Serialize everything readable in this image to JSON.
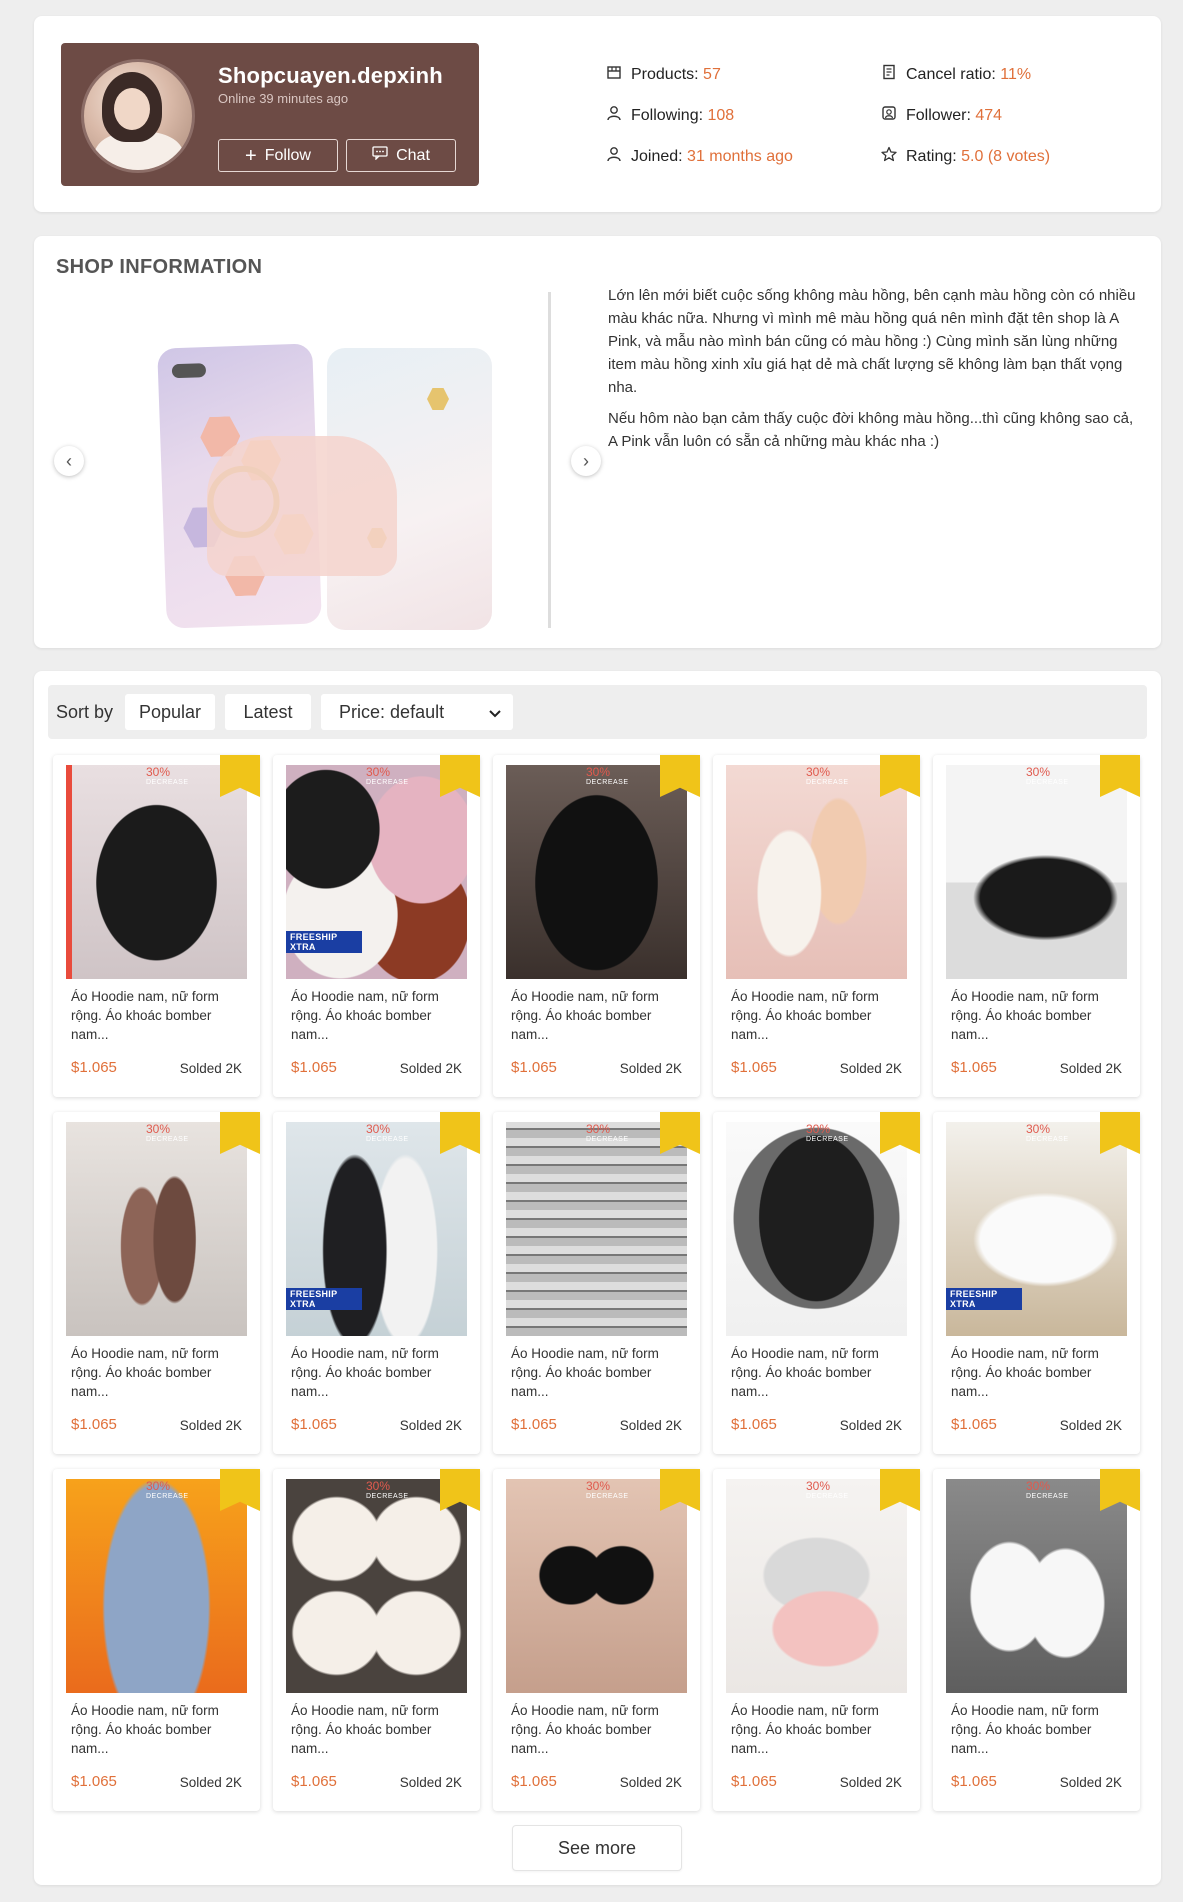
{
  "shop": {
    "name": "Shopcuayen.depxinh",
    "online": "Online 39 minutes ago",
    "follow_label": "Follow",
    "chat_label": "Chat"
  },
  "stats": {
    "products_label": "Products:",
    "products_value": "57",
    "following_label": "Following:",
    "following_value": "108",
    "joined_label": "Joined:",
    "joined_value": "31 months ago",
    "cancel_label": "Cancel ratio:",
    "cancel_value": "11%",
    "follower_label": "Follower:",
    "follower_value": "474",
    "rating_label": "Rating:",
    "rating_value": "5.0 (8 votes)"
  },
  "info": {
    "title": "SHOP INFORMATION",
    "para1": "Lớn lên mới biết cuộc sống không màu hồng, bên cạnh màu hồng còn có nhiều màu khác nữa. Nhưng vì mình mê màu hồng quá nên mình đặt tên shop là A Pink, và mẫu nào mình bán cũng có màu hồng :) Cùng mình săn lùng những item màu hồng xinh xỉu giá hạt dẻ mà chất lượng sẽ không làm bạn thất vọng nha.",
    "para2": "Nếu hôm nào bạn cảm thấy cuộc đời không màu hồng...thì cũng không sao cả, A Pink vẫn luôn có sẵn cả những màu khác nha :)",
    "prev_icon": "‹",
    "next_icon": "›"
  },
  "sort": {
    "label": "Sort by",
    "popular": "Popular",
    "latest": "Latest",
    "price": "Price: default"
  },
  "product": {
    "title": "Áo Hoodie nam, nữ form rộng. Áo khoác bomber nam...",
    "price": "$1.065",
    "sold": "Solded 2K",
    "discount": "30%",
    "decrease": "DECREASE",
    "freeship": "FREESHIP XTRA"
  },
  "products": [
    {
      "theme": "jacket-pink",
      "freeship": false
    },
    {
      "theme": "fur-hoodies",
      "freeship": true
    },
    {
      "theme": "varsity-dark",
      "freeship": false
    },
    {
      "theme": "sandals",
      "freeship": false
    },
    {
      "theme": "sneaker-black",
      "freeship": false
    },
    {
      "theme": "nails",
      "freeship": false
    },
    {
      "theme": "couple",
      "freeship": true
    },
    {
      "theme": "wallpaper",
      "freeship": false
    },
    {
      "theme": "bomber-grey",
      "freeship": false
    },
    {
      "theme": "sneaker-white",
      "freeship": true
    },
    {
      "theme": "jeans",
      "freeship": false
    },
    {
      "theme": "shoes-box",
      "freeship": false
    },
    {
      "theme": "bra",
      "freeship": false
    },
    {
      "theme": "underwear",
      "freeship": false
    },
    {
      "theme": "slides",
      "freeship": false
    }
  ],
  "see_more": "See more",
  "colors": {
    "accent": "#e0703a",
    "banner": "#6d4b45",
    "badge": "#f0c419"
  }
}
